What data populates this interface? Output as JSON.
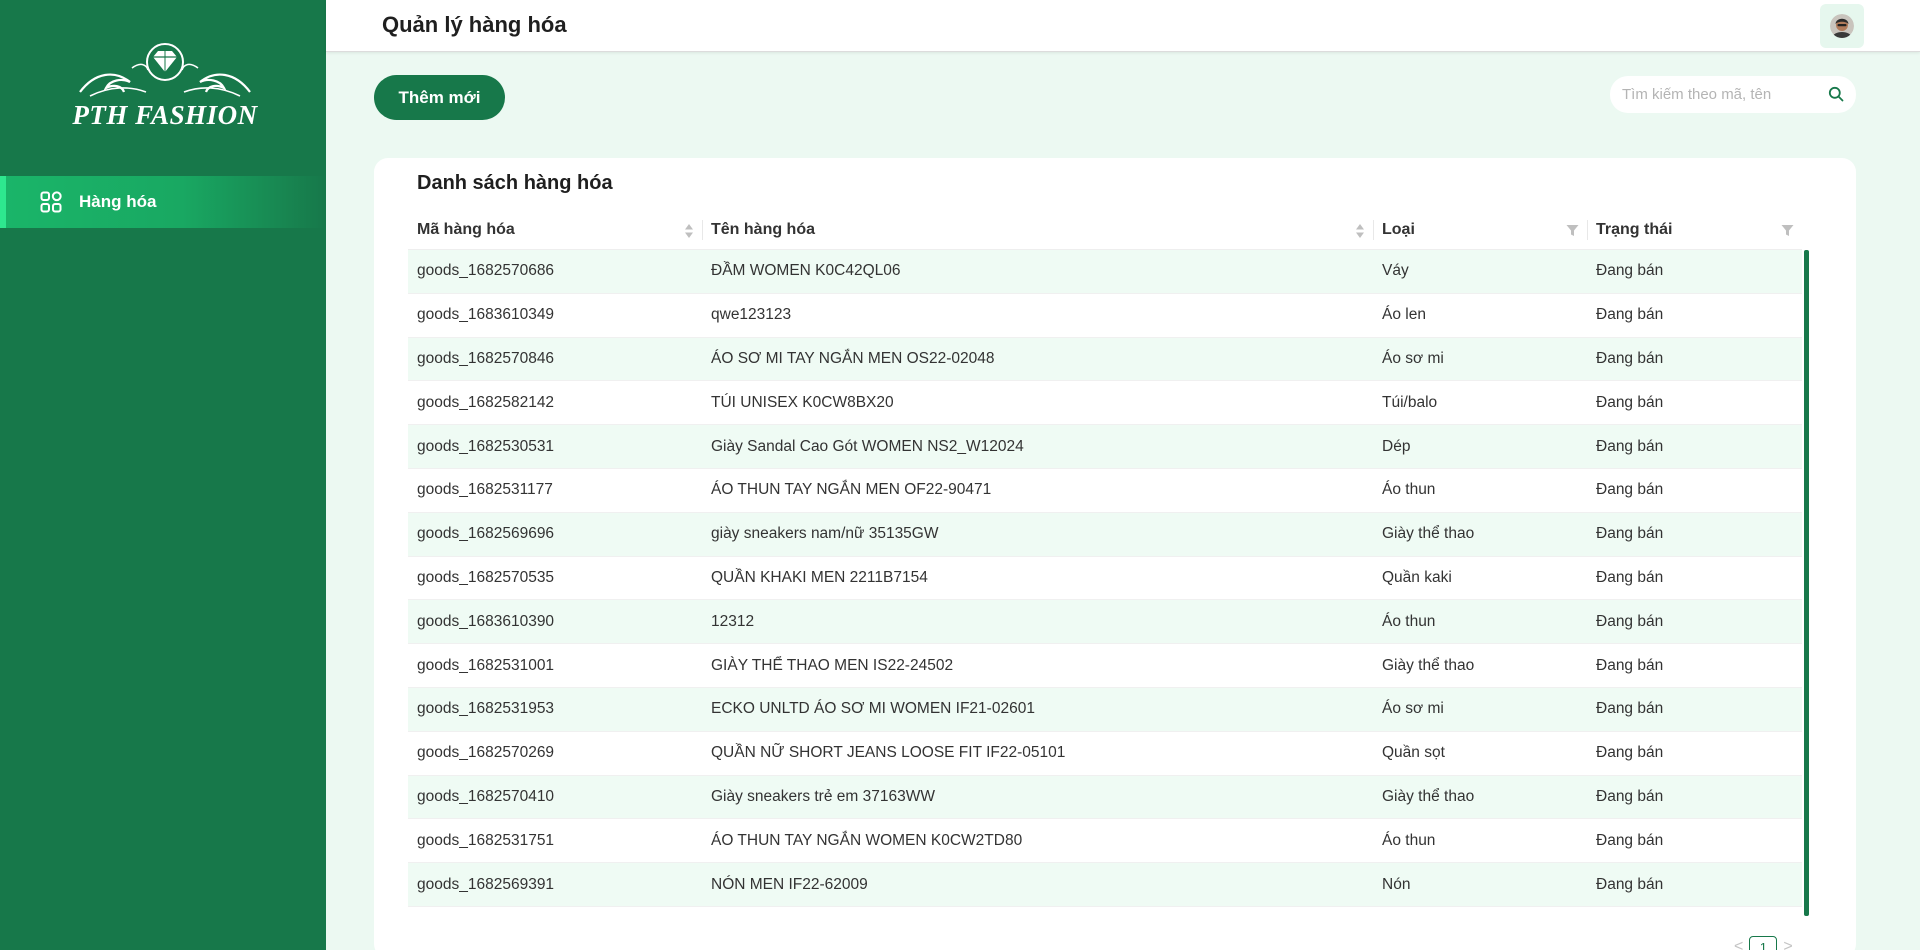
{
  "brand": {
    "name": "PTH FASHION"
  },
  "sidebar": {
    "items": [
      {
        "label": "Hàng hóa",
        "icon": "grid-icon"
      }
    ]
  },
  "header": {
    "title": "Quản lý hàng hóa",
    "avatar": "user-avatar"
  },
  "toolbar": {
    "add_label": "Thêm mới"
  },
  "search": {
    "placeholder": "Tìm kiếm theo mã, tên",
    "value": ""
  },
  "card": {
    "title": "Danh sách hàng hóa"
  },
  "table": {
    "columns": [
      "Mã hàng hóa",
      "Tên hàng hóa",
      "Loại",
      "Trạng thái"
    ],
    "rows": [
      [
        "goods_1682570686",
        "ĐẦM WOMEN K0C42QL06",
        "Váy",
        "Đang bán"
      ],
      [
        "goods_1683610349",
        "qwe123123",
        "Áo len",
        "Đang bán"
      ],
      [
        "goods_1682570846",
        "ÁO SƠ MI TAY NGẮN MEN OS22-02048",
        "Áo sơ mi",
        "Đang bán"
      ],
      [
        "goods_1682582142",
        "TÚI UNISEX K0CW8BX20",
        "Túi/balo",
        "Đang bán"
      ],
      [
        "goods_1682530531",
        "Giày Sandal Cao Gót WOMEN NS2_W12024",
        "Dép",
        "Đang bán"
      ],
      [
        "goods_1682531177",
        "ÁO THUN TAY NGẮN MEN OF22-90471",
        "Áo thun",
        "Đang bán"
      ],
      [
        "goods_1682569696",
        "giày sneakers nam/nữ 35135GW",
        "Giày thể thao",
        "Đang bán"
      ],
      [
        "goods_1682570535",
        "QUẦN KHAKI MEN 2211B7154",
        "Quần kaki",
        "Đang bán"
      ],
      [
        "goods_1683610390",
        "12312",
        "Áo thun",
        "Đang bán"
      ],
      [
        "goods_1682531001",
        "GIÀY THỂ THAO MEN IS22-24502",
        "Giày thể thao",
        "Đang bán"
      ],
      [
        "goods_1682531953",
        "ECKO UNLTD ÁO SƠ MI WOMEN IF21-02601",
        "Áo sơ mi",
        "Đang bán"
      ],
      [
        "goods_1682570269",
        "QUẦN NỮ SHORT JEANS LOOSE FIT IF22-05101",
        "Quần sọt",
        "Đang bán"
      ],
      [
        "goods_1682570410",
        "Giày sneakers trẻ em 37163WW",
        "Giày thể thao",
        "Đang bán"
      ],
      [
        "goods_1682531751",
        "ÁO THUN TAY NGẮN WOMEN K0CW2TD80",
        "Áo thun",
        "Đang bán"
      ],
      [
        "goods_1682569391",
        "NÓN MEN IF22-62009",
        "Nón",
        "Đang bán"
      ]
    ]
  },
  "pagination": {
    "prev": "<",
    "current": "1",
    "next": ">"
  },
  "colors": {
    "sidebar": "#17784a",
    "accent": "#17784a",
    "active_nav": "#1ab569",
    "background": "#ecf9f2",
    "row_alt": "#effbf4"
  }
}
